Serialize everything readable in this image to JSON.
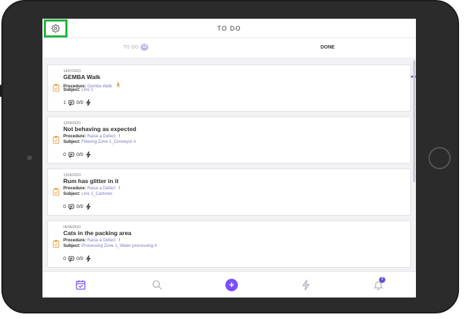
{
  "header": {
    "title": "TO DO",
    "settings_icon": "gear-icon"
  },
  "tabs": [
    {
      "label": "TO DO",
      "badge": "12",
      "active": false
    },
    {
      "label": "DONE",
      "active": true
    }
  ],
  "labels": {
    "procedure": "Procedure:",
    "subject": "Subject:"
  },
  "cards": [
    {
      "date": "14/07/2023",
      "title": "GEMBA Walk",
      "procedure": "Gemba Walk",
      "procedure_flag": "walker-icon",
      "subject": "Line 1",
      "comments": "1",
      "actions": "0/0"
    },
    {
      "date": "13/06/2023",
      "title": "Not behaving as expected",
      "procedure": "Raise a Defect",
      "procedure_flag": "!",
      "subject": "Filtering Zone 1_Conveyor A",
      "comments": "0",
      "actions": "0/0"
    },
    {
      "date": "13/06/2023",
      "title": "Rum has glitter in it",
      "procedure": "Raise a Defect",
      "procedure_flag": "!",
      "subject": "Line 1_Cartoner",
      "comments": "0",
      "actions": "0/0"
    },
    {
      "date": "06/06/2023",
      "title": "Cats in the packing area",
      "procedure": "Raise a Defect",
      "procedure_flag": "!",
      "subject": "Processing Zone 1_Water processing A",
      "comments": "0",
      "actions": "0/0"
    }
  ],
  "bottom_nav": [
    {
      "name": "calendar-check-icon",
      "active": true
    },
    {
      "name": "search-icon"
    },
    {
      "name": "add-icon",
      "label": "+"
    },
    {
      "name": "lightning-icon"
    },
    {
      "name": "bell-icon",
      "badge": "7"
    }
  ],
  "colors": {
    "accent": "#8a6bd8",
    "highlight": "#1db33a",
    "link": "#7a78c4",
    "warning": "#e53935",
    "icon_orange": "#f0a14a"
  }
}
